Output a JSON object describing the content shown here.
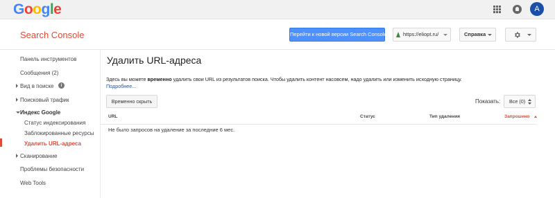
{
  "header": {
    "logo_letters": [
      {
        "ch": "G",
        "color": "#4285f4"
      },
      {
        "ch": "o",
        "color": "#ea4335"
      },
      {
        "ch": "o",
        "color": "#fbbc05"
      },
      {
        "ch": "g",
        "color": "#4285f4"
      },
      {
        "ch": "l",
        "color": "#34a853"
      },
      {
        "ch": "e",
        "color": "#ea4335"
      }
    ],
    "avatar_initial": "A",
    "apps_icon": "apps-grid-icon",
    "notifications_icon": "bell-icon"
  },
  "toolbar": {
    "product_title": "Search Console",
    "new_version_button": "Перейти к новой версии Search Console",
    "site_selector": "https://eliopt.ru/",
    "help_button": "Справка",
    "settings_icon": "gear-icon"
  },
  "sidebar": {
    "items": [
      {
        "label": "Панель инструментов"
      },
      {
        "label": "Сообщения (2)"
      },
      {
        "label": "Вид в поиске"
      },
      {
        "label": "Поисковый трафик"
      },
      {
        "label": "Индекс Google"
      },
      {
        "label": "Статус индексирования"
      },
      {
        "label": "Заблокированные ресурсы"
      },
      {
        "label": "Удалить URL-адреса"
      },
      {
        "label": "Сканирование"
      },
      {
        "label": "Проблемы безопасности"
      },
      {
        "label": "Web Tools"
      }
    ],
    "info_icon_label": "i"
  },
  "main": {
    "title": "Удалить URL-адреса",
    "description_pre": "Здесь вы можете ",
    "description_bold": "временно",
    "description_post": " удалить свои URL из результатов поиска. Чтобы удалить контент насовсем, надо удалить или изменить исходную страницу.",
    "more_link": "Подробнее...",
    "temp_hide_button": "Временно скрыть",
    "show_label": "Показать:",
    "show_select_value": "Все (0)",
    "table": {
      "columns": [
        "URL",
        "Статус",
        "Тип удаления",
        "Запрошено"
      ],
      "sorted_column": "Запрошено",
      "empty_message": "Не было запросов на удаление за последние 6 мес."
    }
  },
  "colors": {
    "accent": "#dd4b39",
    "primary_button": "#4d90fe",
    "link": "#1155cc"
  }
}
